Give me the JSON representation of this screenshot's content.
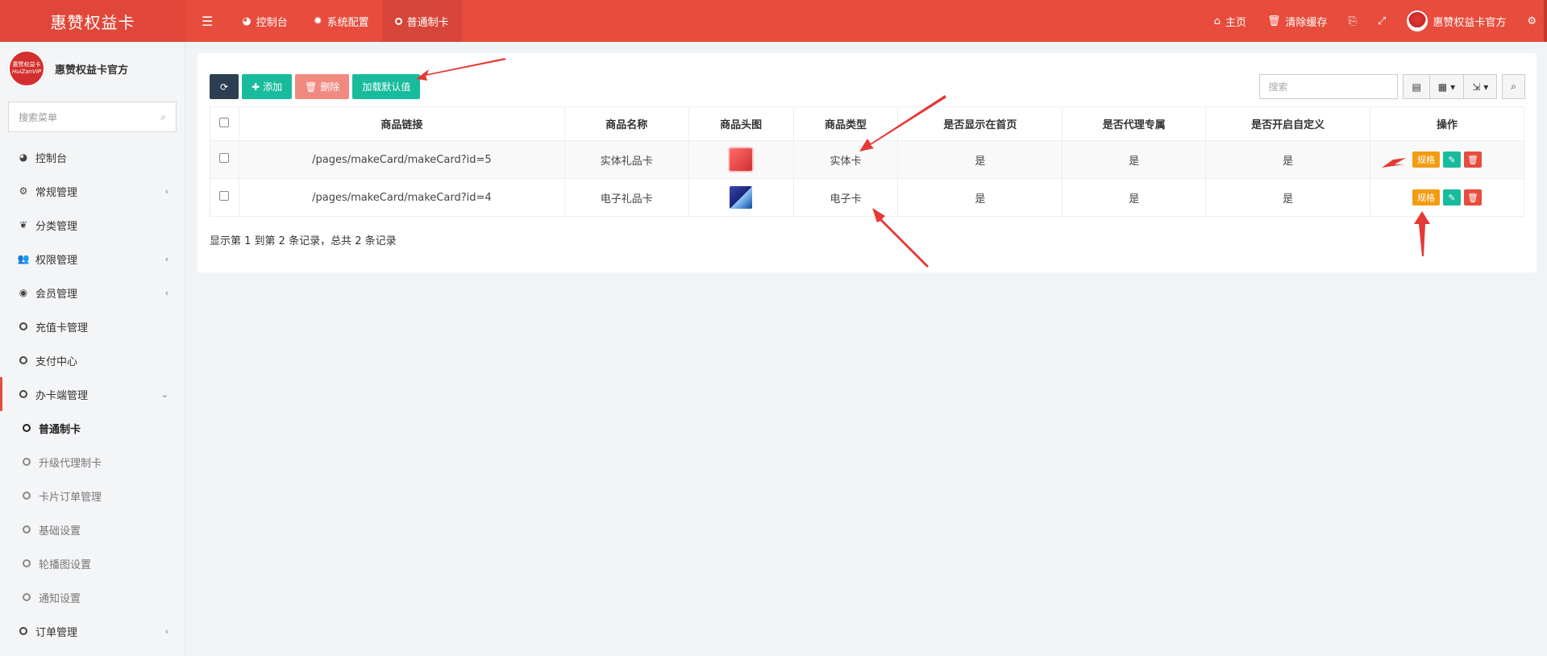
{
  "topbar": {
    "brand": "惠赞权益卡",
    "nav": [
      {
        "label": "控制台",
        "icon": "dashboard-icon"
      },
      {
        "label": "系统配置",
        "icon": "gear-icon"
      },
      {
        "label": "普通制卡",
        "icon": "circle-icon"
      }
    ],
    "right": {
      "home": "主页",
      "clear_cache": "清除缓存",
      "user": "惠赞权益卡官方"
    }
  },
  "sidebar": {
    "username": "惠赞权益卡官方",
    "logo_line1": "惠赞权益卡",
    "logo_line2": "HuiZanVIP",
    "search_placeholder": "搜索菜单",
    "items": [
      {
        "label": "控制台"
      },
      {
        "label": "常规管理"
      },
      {
        "label": "分类管理"
      },
      {
        "label": "权限管理"
      },
      {
        "label": "会员管理"
      },
      {
        "label": "充值卡管理"
      },
      {
        "label": "支付中心"
      },
      {
        "label": "办卡端管理"
      },
      {
        "label": "普通制卡"
      },
      {
        "label": "升级代理制卡"
      },
      {
        "label": "卡片订单管理"
      },
      {
        "label": "基础设置"
      },
      {
        "label": "轮播图设置"
      },
      {
        "label": "通知设置"
      },
      {
        "label": "订单管理"
      }
    ]
  },
  "toolbar": {
    "add": "添加",
    "delete": "删除",
    "load_default": "加载默认值",
    "search_placeholder": "搜索"
  },
  "table": {
    "columns": [
      "商品链接",
      "商品名称",
      "商品头图",
      "商品类型",
      "是否显示在首页",
      "是否代理专属",
      "是否开启自定义",
      "操作"
    ],
    "rows": [
      {
        "link": "/pages/makeCard/makeCard?id=5",
        "name": "实体礼品卡",
        "type": "实体卡",
        "home": "是",
        "agent": "是",
        "custom": "是"
      },
      {
        "link": "/pages/makeCard/makeCard?id=4",
        "name": "电子礼品卡",
        "type": "电子卡",
        "home": "是",
        "agent": "是",
        "custom": "是"
      }
    ],
    "action_label": "规格",
    "summary": "显示第 1 到第 2 条记录，总共 2 条记录"
  },
  "colors": {
    "primary": "#e74c3c",
    "success": "#18bc9c",
    "warning": "#f39c12",
    "dark": "#2c3e50"
  }
}
